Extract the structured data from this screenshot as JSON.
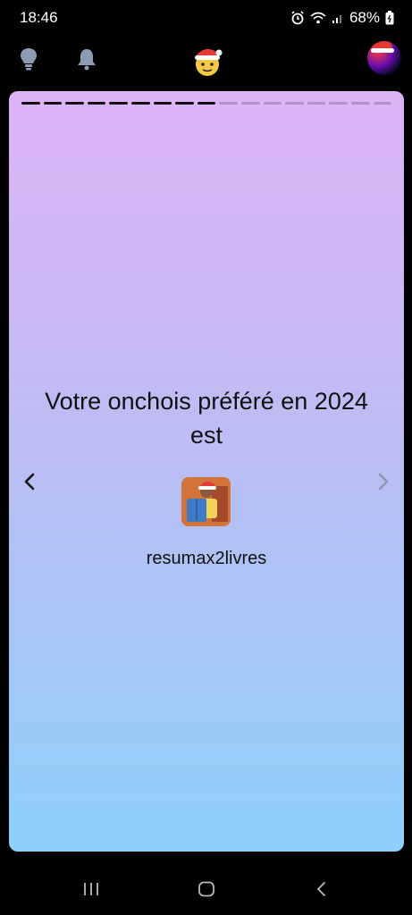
{
  "status_bar": {
    "time": "18:46",
    "battery": "68%"
  },
  "icons": {
    "alarm": "alarm-icon",
    "wifi": "wifi-icon",
    "signal": "signal-icon",
    "battery": "battery-icon",
    "bulb": "lightbulb-icon",
    "bell": "bell-icon",
    "mascot": "santa-mascot-icon",
    "prev": "chevron-left-icon",
    "next": "chevron-right-icon",
    "recents": "recent-apps-icon",
    "home": "home-icon",
    "back": "back-icon"
  },
  "story": {
    "progress": {
      "completed_segments": 9,
      "total_segments": 17
    },
    "headline": "Votre onchois préféré en 2024 est",
    "username": "resumax2livres"
  },
  "colors": {
    "gradient_top": "#dcb4f6",
    "gradient_bottom": "#8dd0fb",
    "progress_done": "#111111"
  }
}
